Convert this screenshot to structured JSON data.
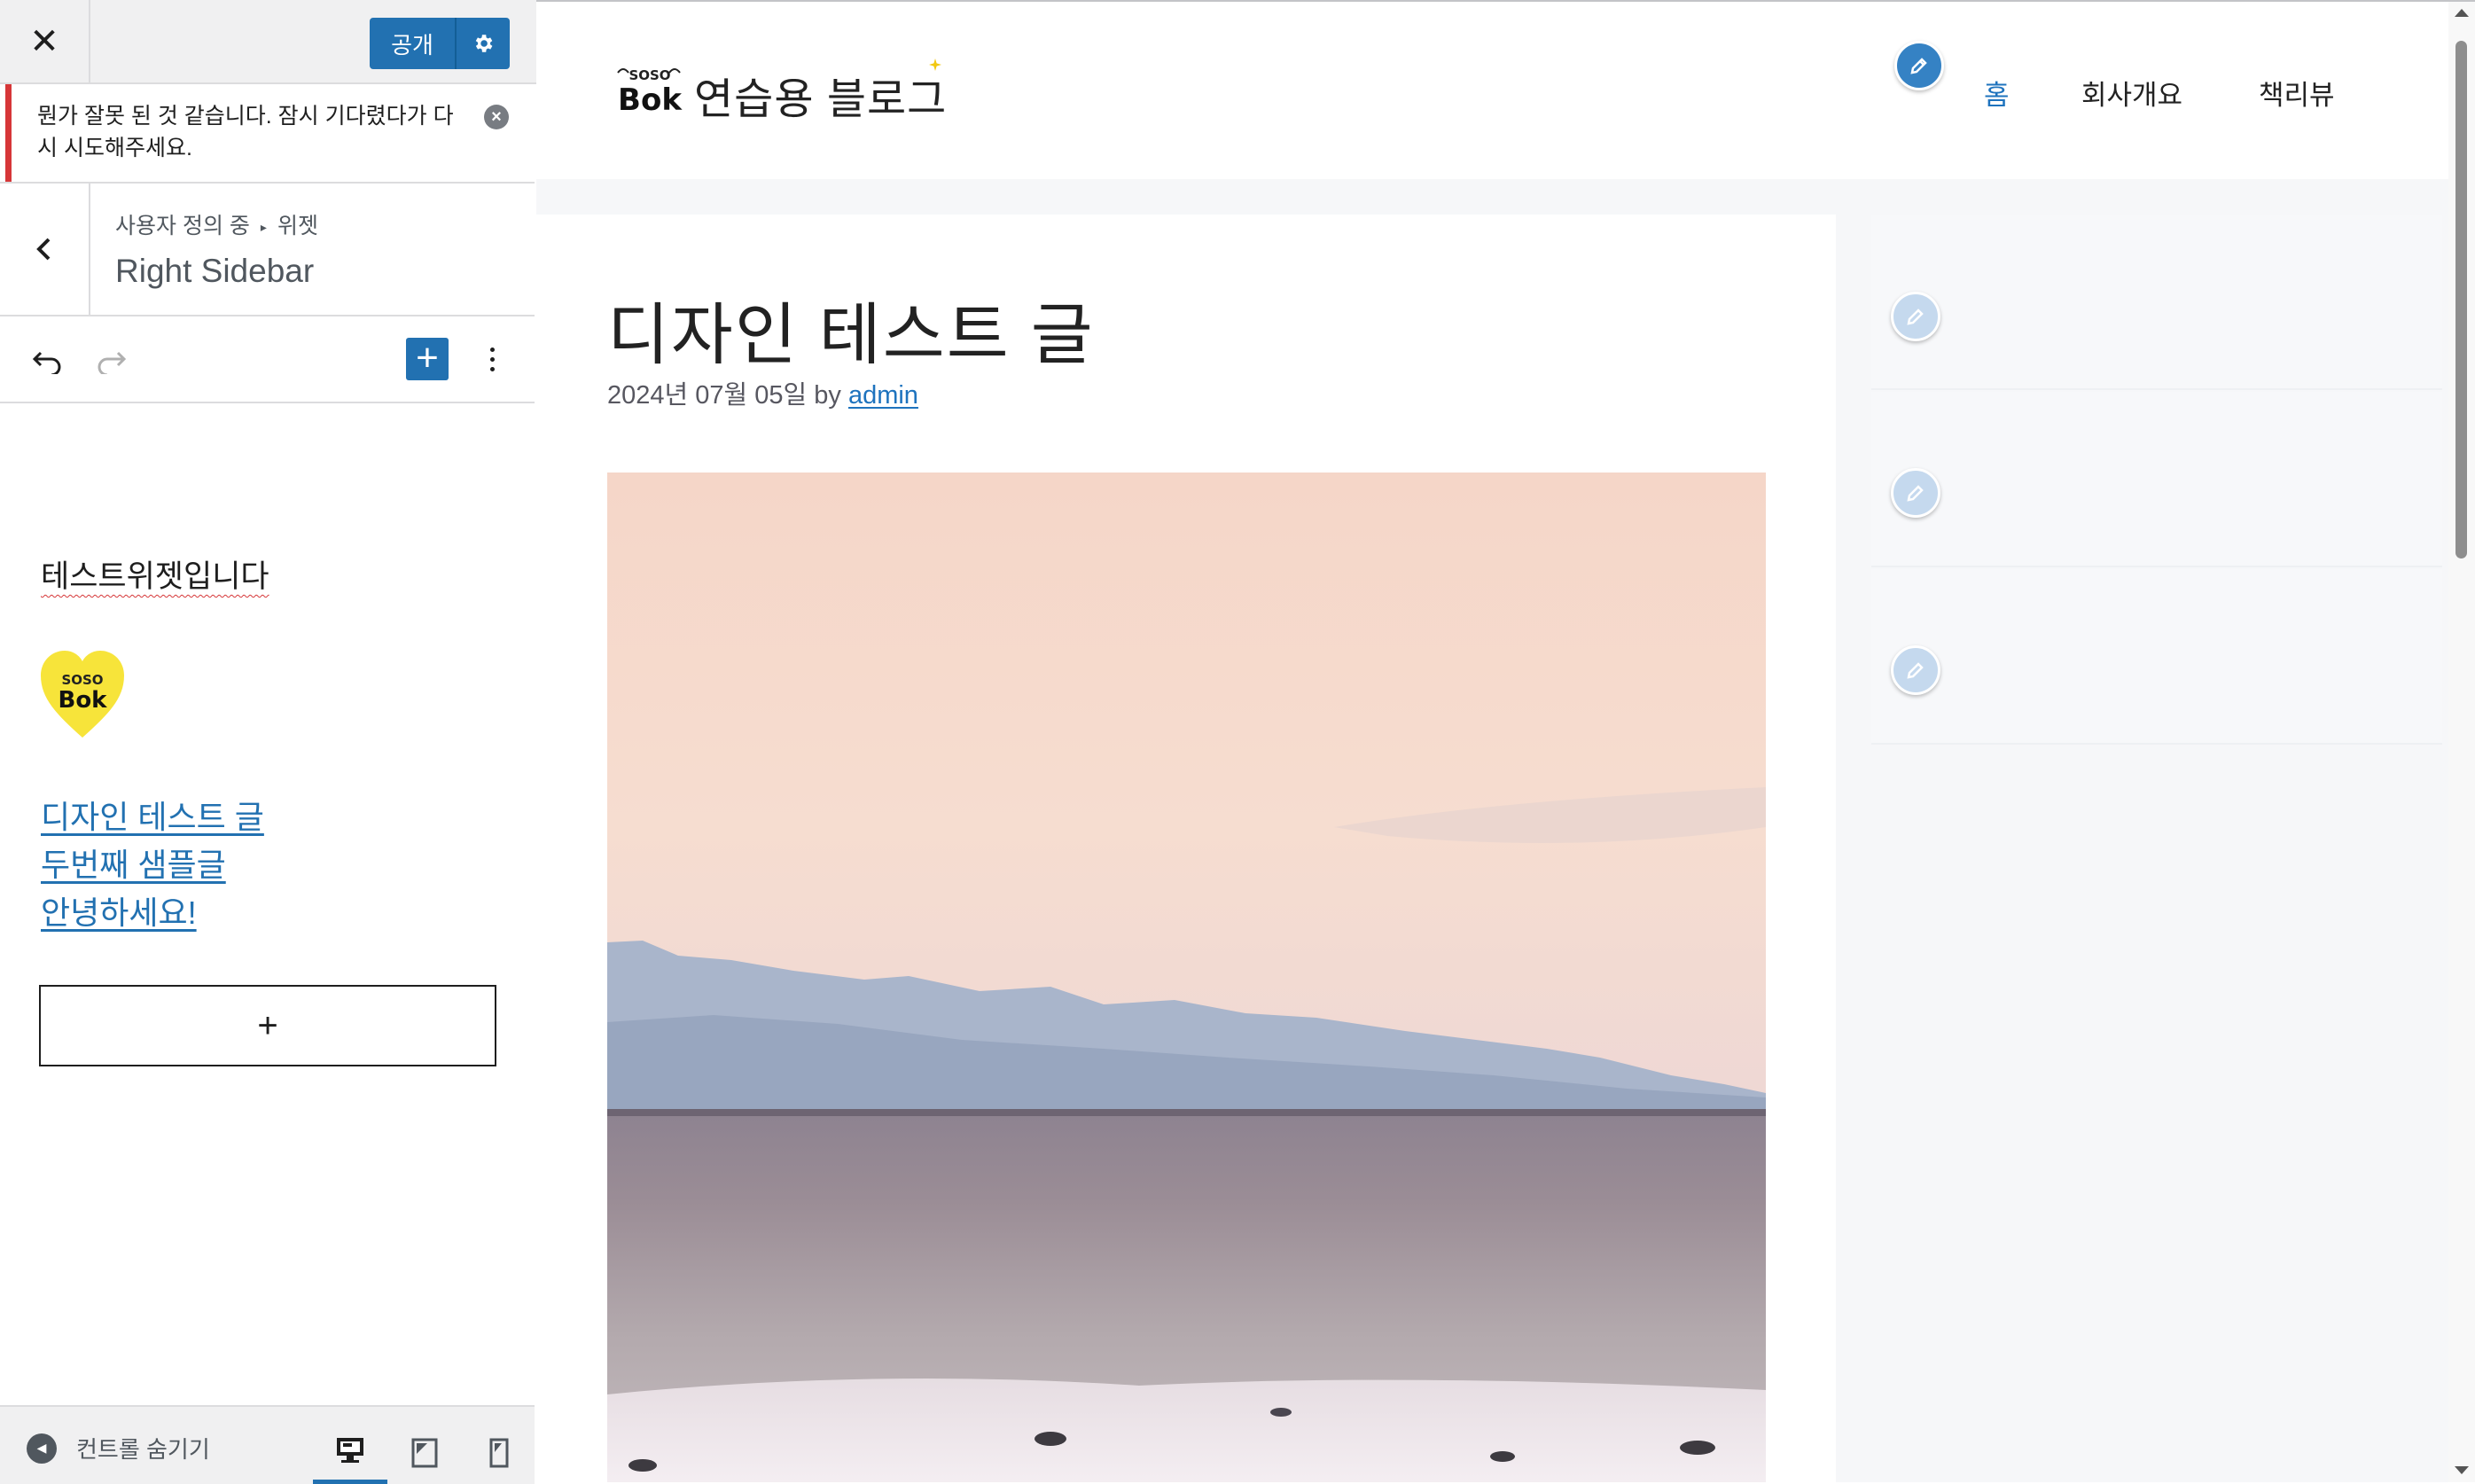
{
  "customizer": {
    "close_label": "✕",
    "publish_label": "공개",
    "notice": "뭔가 잘못 된 것 같습니다. 잠시 기다렸다가 다시 시도해주세요.",
    "breadcrumb": {
      "parent": "사용자 정의 중",
      "child": "위젯"
    },
    "section_title": "Right Sidebar",
    "block_toolbar": {
      "add_label": "+"
    },
    "widget": {
      "heading": "테스트위젯입니다",
      "logo_text_top": "SOSO",
      "logo_text_bottom": "Bok",
      "links": [
        "디자인 테스트 글",
        "두번째 샘플글",
        "안녕하세요!"
      ],
      "appender_label": "+"
    },
    "footer": {
      "collapse_label": "컨트롤 숨기기"
    }
  },
  "site": {
    "logo_text_top": "SOSO",
    "logo_text_bottom": "Bok",
    "title": "연습용 블로그",
    "nav": [
      "홈",
      "회사개요",
      "책리뷰"
    ],
    "nav_current_index": 0
  },
  "post": {
    "title": "디자인 테스트 글",
    "date": "2024년 07월 05일",
    "by": "by",
    "author": "admin"
  },
  "colors": {
    "accent": "#2271b1",
    "error": "#d63638",
    "link": "#1e73be"
  }
}
